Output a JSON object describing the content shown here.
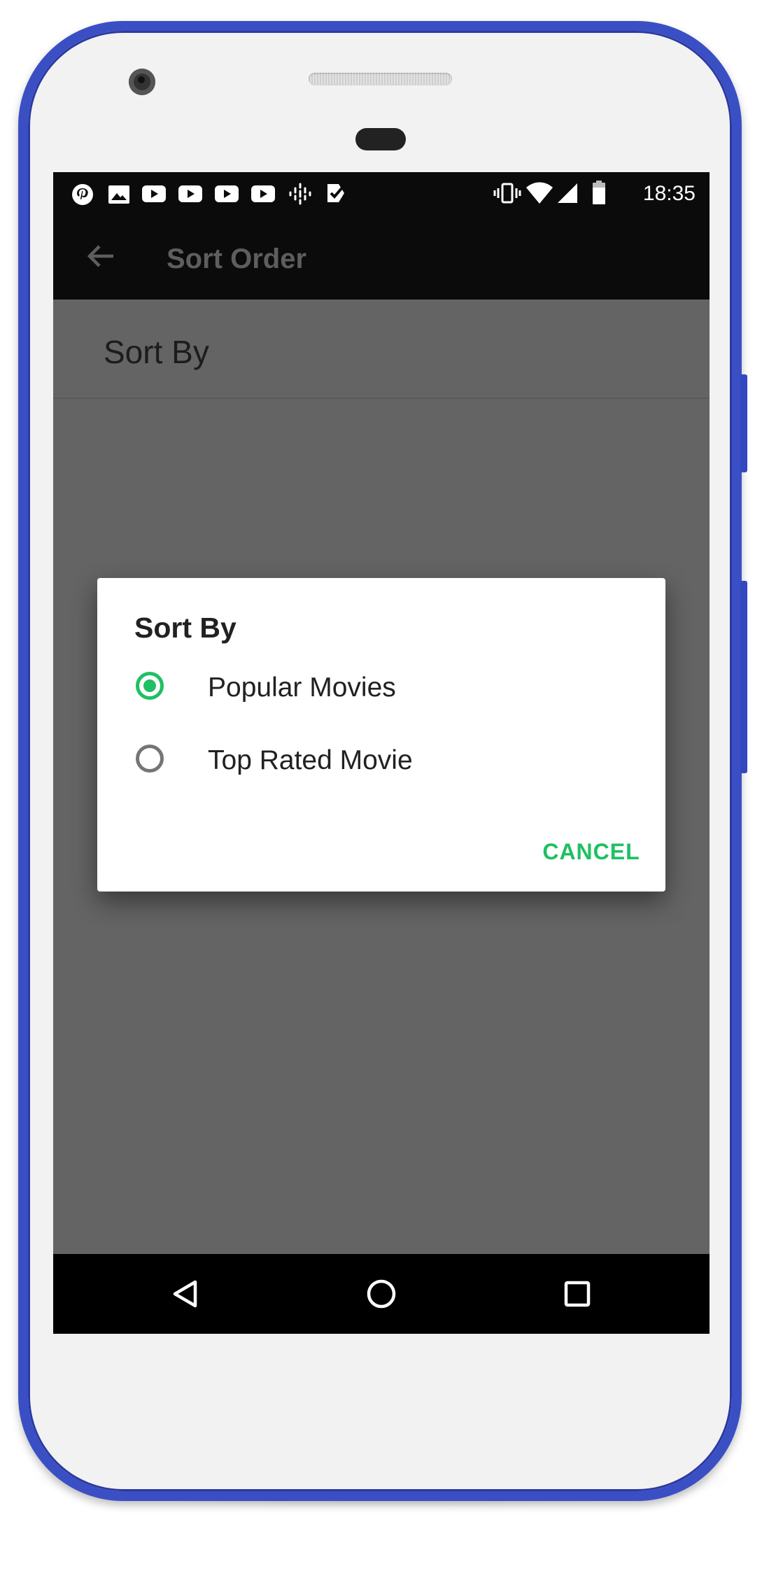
{
  "status_bar": {
    "time": "18:35",
    "left_icons": [
      "pinterest-icon",
      "gallery-icon",
      "youtube-icon",
      "youtube-icon",
      "youtube-icon",
      "youtube-icon",
      "podcast-icon",
      "task-icon"
    ],
    "right_icons": [
      "vibrate-icon",
      "wifi-icon",
      "signal-icon",
      "battery-icon"
    ]
  },
  "app_bar": {
    "title": "Sort Order",
    "back_icon": "arrow-back-icon"
  },
  "preference": {
    "title": "Sort By"
  },
  "dialog": {
    "title": "Sort By",
    "options": [
      {
        "label": "Popular Movies",
        "checked": true
      },
      {
        "label": "Top Rated Movie",
        "checked": false
      }
    ],
    "cancel_label": "CANCEL"
  },
  "nav_bar": {
    "buttons": [
      "back-icon",
      "home-icon",
      "recents-icon"
    ]
  },
  "colors": {
    "accent": "#1fc063",
    "phone_frame": "#3b4fc4",
    "scrim": "#646464"
  }
}
